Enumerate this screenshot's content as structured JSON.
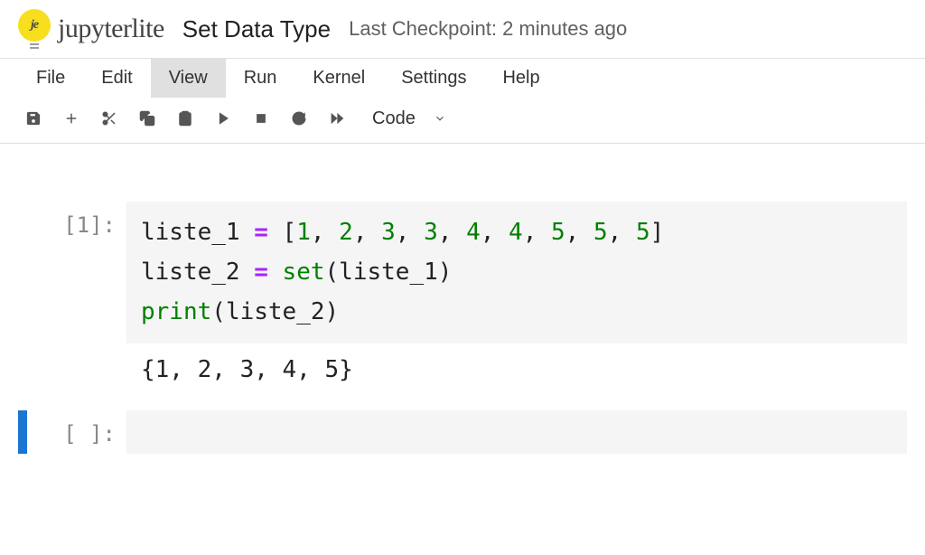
{
  "logo": {
    "initials": "je",
    "brand": "jupyterlite"
  },
  "title": "Set Data Type",
  "checkpoint": "Last Checkpoint: 2 minutes ago",
  "menu": {
    "file": "File",
    "edit": "Edit",
    "view": "View",
    "run": "Run",
    "kernel": "Kernel",
    "settings": "Settings",
    "help": "Help"
  },
  "toolbar": {
    "cell_type": "Code"
  },
  "cells": [
    {
      "prompt": "[1]:",
      "code": {
        "line1": {
          "var": "liste_1",
          "eq": "=",
          "lb": "[",
          "n1": "1",
          "c1": ", ",
          "n2": "2",
          "c2": ", ",
          "n3": "3",
          "c3": ", ",
          "n4": "3",
          "c4": ", ",
          "n5": "4",
          "c5": ", ",
          "n6": "4",
          "c6": ", ",
          "n7": "5",
          "c7": ", ",
          "n8": "5",
          "c8": ", ",
          "n9": "5",
          "rb": "]"
        },
        "line2": {
          "var": "liste_2",
          "eq": "=",
          "fn": "set",
          "lp": "(",
          "arg": "liste_1",
          "rp": ")"
        },
        "line3": {
          "fn": "print",
          "lp": "(",
          "arg": "liste_2",
          "rp": ")"
        }
      },
      "output": "{1, 2, 3, 4, 5}"
    },
    {
      "prompt": "[ ]:"
    }
  ]
}
